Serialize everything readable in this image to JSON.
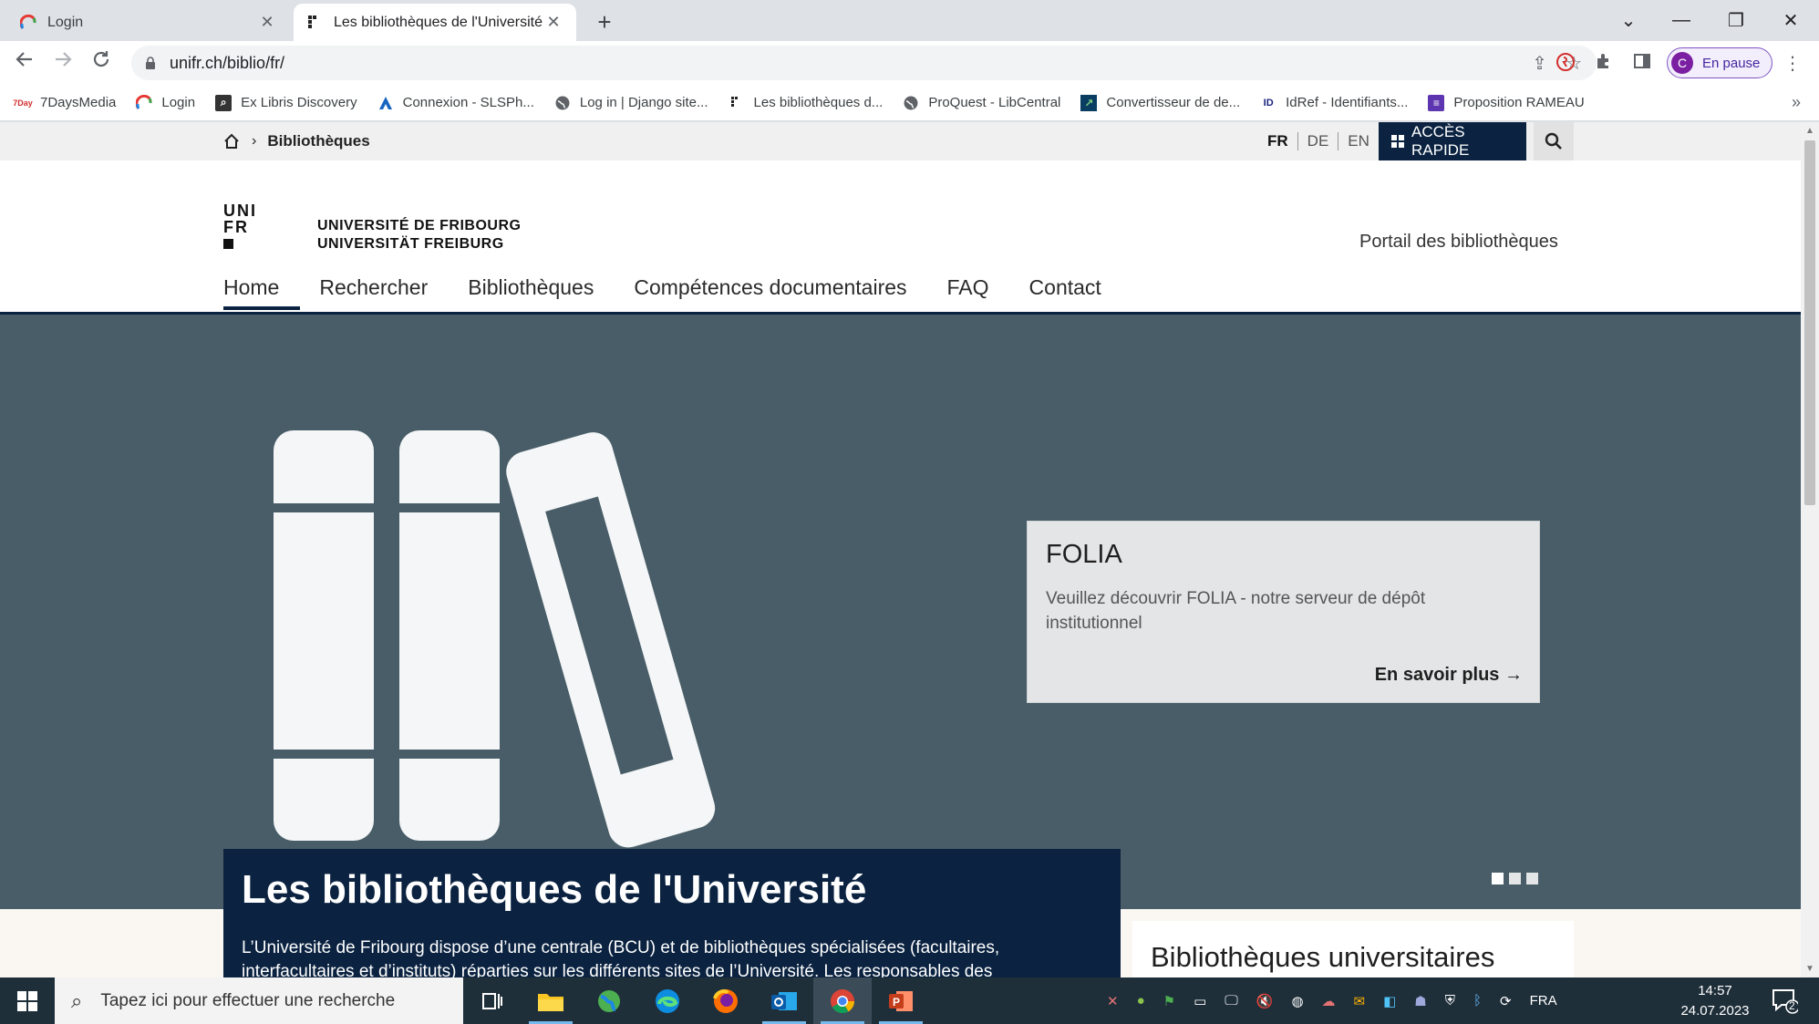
{
  "browser": {
    "tabs": [
      {
        "title": "Login",
        "active": false
      },
      {
        "title": "Les bibliothèques de l'Université",
        "active": true
      }
    ],
    "new_tab_label": "+",
    "window_controls": {
      "tabs_menu": "⌄",
      "minimize": "—",
      "restore": "❐",
      "close": "✕"
    },
    "url": "unifr.ch/biblio/fr/",
    "profile": {
      "initial": "C",
      "label": "En pause"
    },
    "bookmarks": [
      {
        "label": "7DaysMedia",
        "icon": "7days-icon"
      },
      {
        "label": "Login",
        "icon": "login-icon"
      },
      {
        "label": "Ex Libris Discovery",
        "icon": "exlibris-icon"
      },
      {
        "label": "Connexion - SLSPh...",
        "icon": "slsp-icon"
      },
      {
        "label": "Log in | Django site...",
        "icon": "globe-icon"
      },
      {
        "label": "Les bibliothèques d...",
        "icon": "unifr-icon"
      },
      {
        "label": "ProQuest - LibCentral",
        "icon": "globe-icon"
      },
      {
        "label": "Convertisseur de de...",
        "icon": "converter-icon"
      },
      {
        "label": "IdRef - Identifiants...",
        "icon": "idref-icon"
      },
      {
        "label": "Proposition RAMEAU",
        "icon": "rameau-icon"
      }
    ],
    "bookmarks_more": "»"
  },
  "page": {
    "breadcrumb": {
      "current": "Bibliothèques"
    },
    "languages": [
      {
        "code": "FR",
        "current": true
      },
      {
        "code": "DE",
        "current": false
      },
      {
        "code": "EN",
        "current": false
      }
    ],
    "quick_access_label": "ACCÈS RAPIDE",
    "university_name": {
      "fr": "UNIVERSITÉ DE FRIBOURG",
      "de": "UNIVERSITÄT FREIBURG"
    },
    "logo_text": "UNI FR",
    "portal_label": "Portail des bibliothèques",
    "nav": [
      "Home",
      "Rechercher",
      "Bibliothèques",
      "Compétences documentaires",
      "FAQ",
      "Contact"
    ],
    "slide": {
      "title": "FOLIA",
      "text": "Veuillez découvrir FOLIA - notre serveur de dépôt institutionnel",
      "link": "En savoir plus",
      "dots": [
        true,
        false,
        false
      ]
    },
    "intro": {
      "title": "Les bibliothèques de l'Université",
      "text": "L’Université de Fribourg dispose d’une centrale (BCU) et de bibliothèques spécialisées (facultaires, interfacultaires et d’instituts) réparties sur les différents sites de l’Université. Les responsables des"
    },
    "side_title": "Bibliothèques universitaires"
  },
  "taskbar": {
    "search_placeholder": "Tapez ici pour effectuer une recherche",
    "apps": [
      "task-view-icon",
      "file-explorer-icon",
      "globe-app-icon",
      "edge-icon",
      "firefox-icon",
      "outlook-icon",
      "chrome-icon",
      "powerpoint-icon"
    ],
    "language": "FRA",
    "time": "14:57",
    "date": "24.07.2023",
    "notification_count": "2"
  },
  "colors": {
    "unifr_navy": "#0b2341",
    "hero_bg": "#485d68",
    "taskbar_bg": "#1f2f3a"
  }
}
